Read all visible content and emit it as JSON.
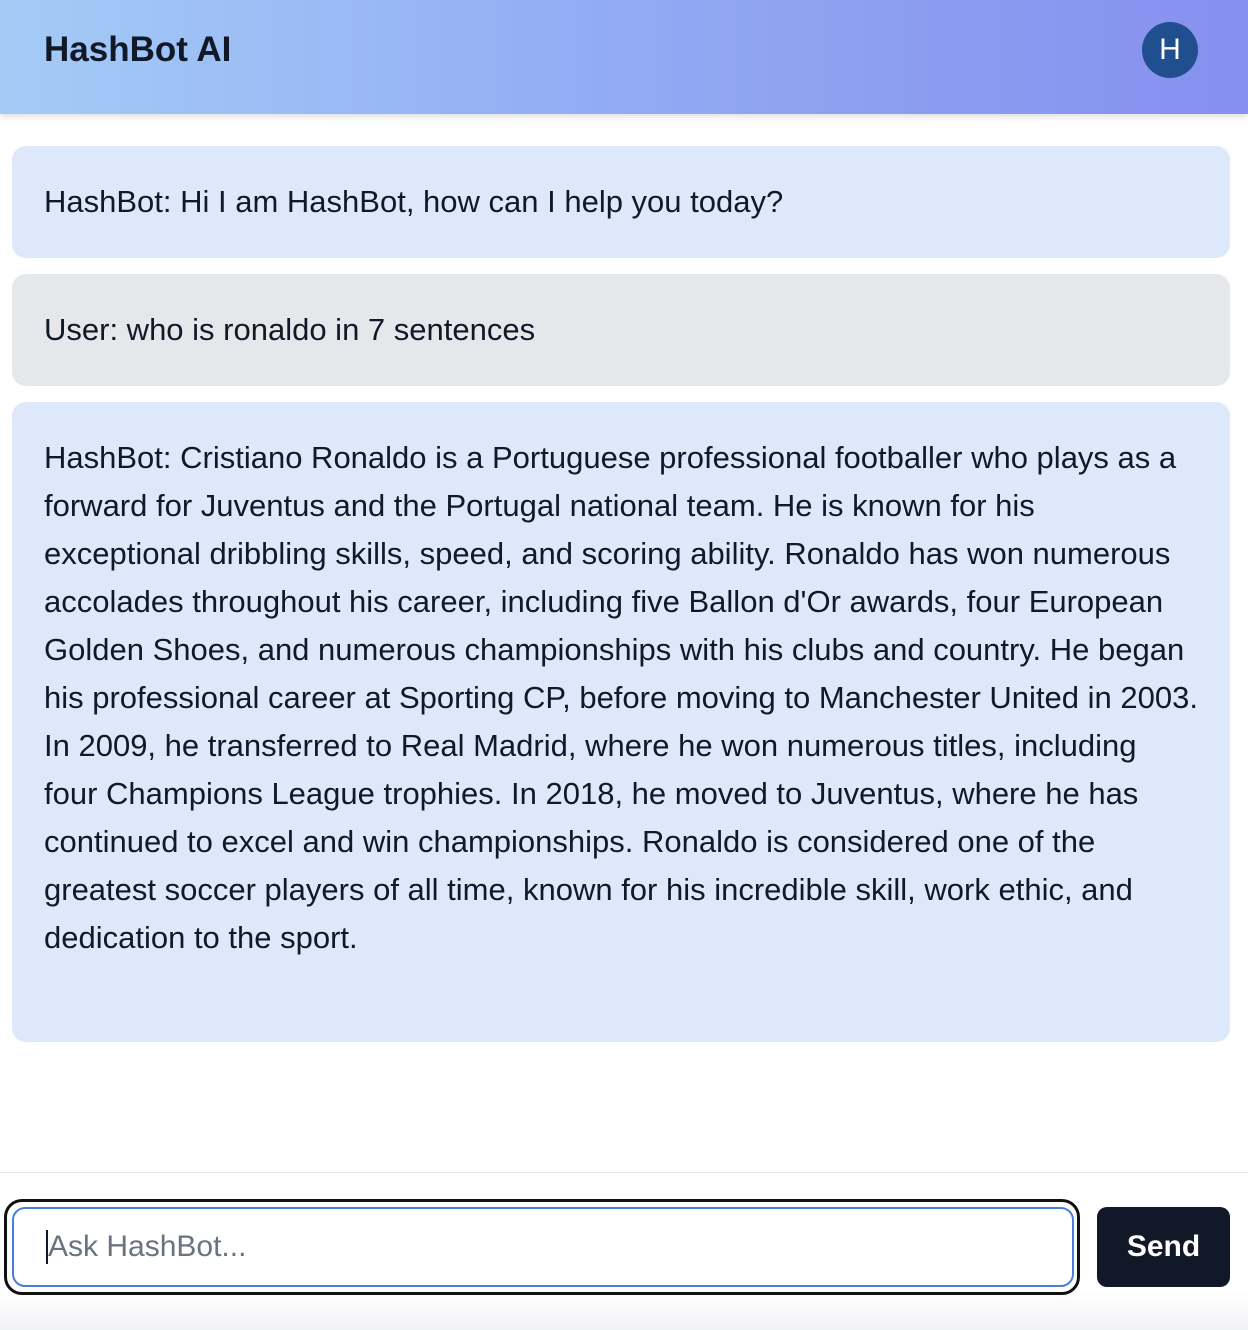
{
  "header": {
    "title": "HashBot AI",
    "avatar_initial": "H"
  },
  "messages": [
    {
      "role": "bot",
      "text": "HashBot: Hi I am HashBot, how can I help you today?"
    },
    {
      "role": "user",
      "text": "User: who is ronaldo in 7 sentences"
    },
    {
      "role": "bot",
      "text": "HashBot: Cristiano Ronaldo is a Portuguese professional footballer who plays as a forward for Juventus and the Portugal national team. He is known for his exceptional dribbling skills, speed, and scoring ability. Ronaldo has won numerous accolades throughout his career, including five Ballon d'Or awards, four European Golden Shoes, and numerous championships with his clubs and country. He began his professional career at Sporting CP, before moving to Manchester United in 2003. In 2009, he transferred to Real Madrid, where he won numerous titles, including four Champions League trophies. In 2018, he moved to Juventus, where he has continued to excel and win championships. Ronaldo is considered one of the greatest soccer players of all time, known for his incredible skill, work ethic, and dedication to the sport."
    }
  ],
  "composer": {
    "placeholder": "Ask HashBot...",
    "value": "",
    "send_label": "Send"
  },
  "colors": {
    "header_gradient_start": "#a4cbf6",
    "header_gradient_end": "#8690ef",
    "avatar_bg": "#1f4f8f",
    "bot_bubble": "#dde8fa",
    "user_bubble": "#e5e7eb",
    "send_button": "#111827",
    "input_focus": "#4a7fd8"
  }
}
